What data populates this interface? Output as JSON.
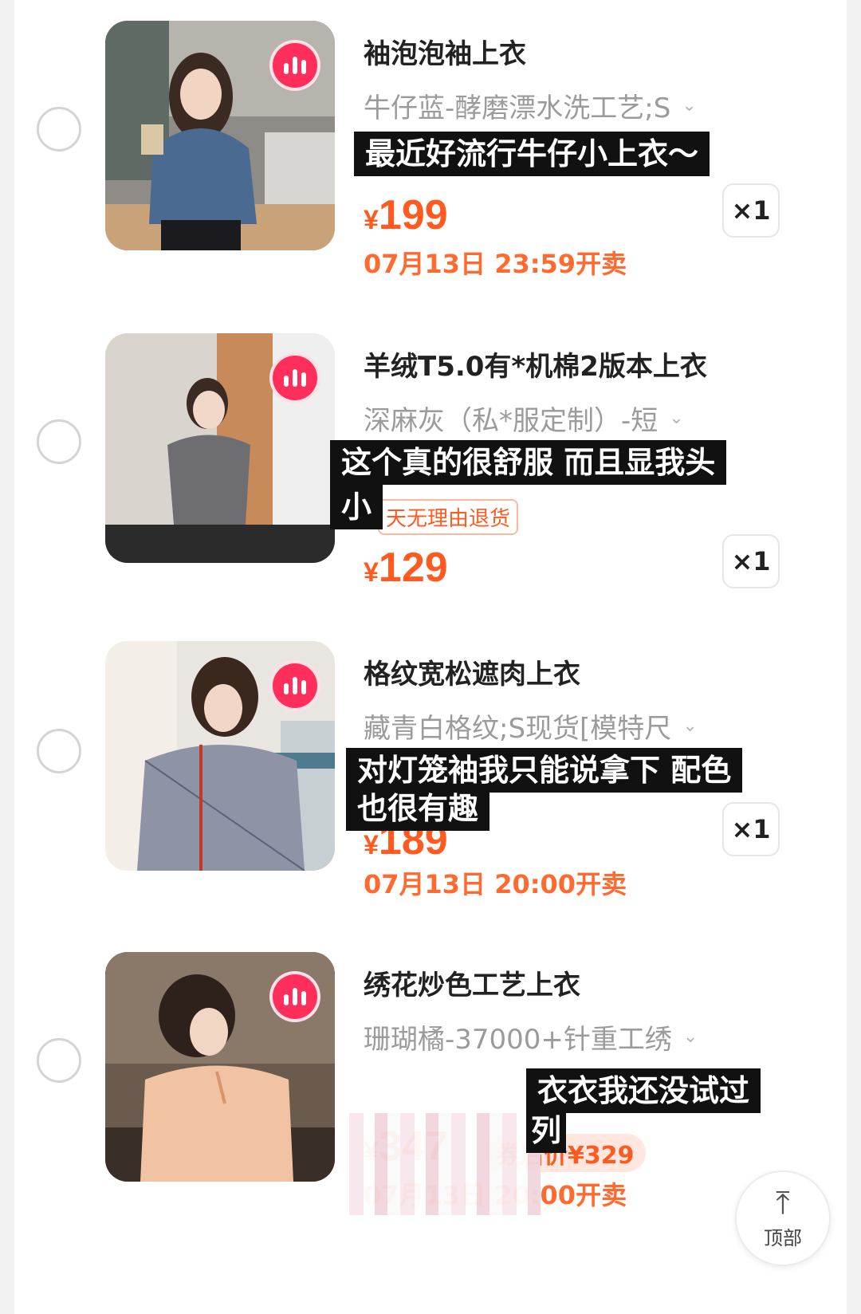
{
  "products": [
    {
      "title": "袖泡泡袖上衣",
      "sku": "牛仔蓝-酵磨漂水洗工艺;S",
      "subtitle": "最近好流行牛仔小上衣～",
      "price_currency": "¥",
      "price_amount": "199",
      "sale_time": "07月13日 23:59开卖",
      "quantity": "×1"
    },
    {
      "title": "羊绒T5.0有*机棉2版本上衣",
      "sku": "深麻灰（私*服定制）-短",
      "subtitle_line1": "这个真的很舒服 而且显我头",
      "subtitle_line2": "小",
      "tag": "天无理由退货",
      "price_currency": "¥",
      "price_amount": "129",
      "quantity": "×1"
    },
    {
      "title": "格纹宽松遮肉上衣",
      "sku": "藏青白格纹;S现货[模特尺",
      "subtitle_line1": "对灯笼袖我只能说拿下 配色",
      "subtitle_line2": "也很有趣",
      "price_currency": "¥",
      "price_amount": "189",
      "sale_time": "07月13日 20:00开卖",
      "quantity": "×1"
    },
    {
      "title": "绣花炒色工艺上衣",
      "sku": "珊瑚橘-37000+针重工绣",
      "subtitle_line1": "衣衣我还没试过",
      "subtitle_line2": "列",
      "price_currency": "¥",
      "price_amount": "347",
      "coupon": "券后价¥329",
      "sale_time": "07月13日 20:00开卖"
    }
  ],
  "back_to_top": {
    "icon": "arrow-up-to-line-icon",
    "label": "顶部"
  },
  "colors": {
    "accent": "#ff5a1f",
    "live_badge": "#ff2e5a"
  }
}
